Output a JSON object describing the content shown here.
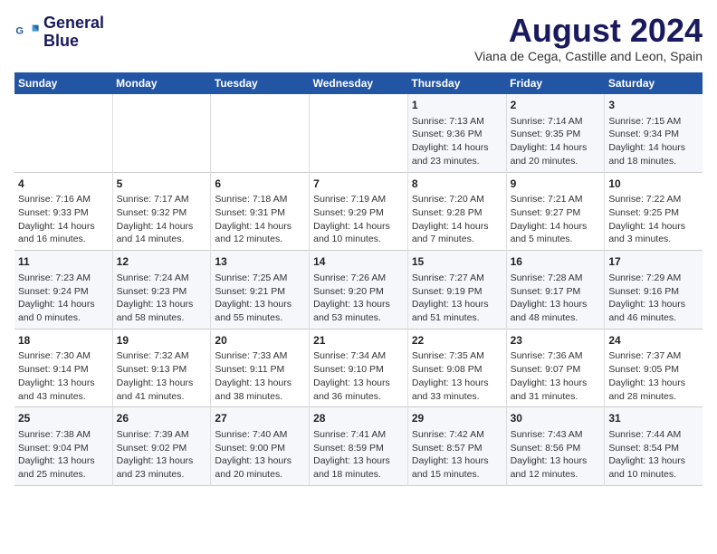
{
  "header": {
    "logo_line1": "General",
    "logo_line2": "Blue",
    "month": "August 2024",
    "location": "Viana de Cega, Castille and Leon, Spain"
  },
  "days_of_week": [
    "Sunday",
    "Monday",
    "Tuesday",
    "Wednesday",
    "Thursday",
    "Friday",
    "Saturday"
  ],
  "weeks": [
    [
      {
        "day": "",
        "content": ""
      },
      {
        "day": "",
        "content": ""
      },
      {
        "day": "",
        "content": ""
      },
      {
        "day": "",
        "content": ""
      },
      {
        "day": "1",
        "content": "Sunrise: 7:13 AM\nSunset: 9:36 PM\nDaylight: 14 hours\nand 23 minutes."
      },
      {
        "day": "2",
        "content": "Sunrise: 7:14 AM\nSunset: 9:35 PM\nDaylight: 14 hours\nand 20 minutes."
      },
      {
        "day": "3",
        "content": "Sunrise: 7:15 AM\nSunset: 9:34 PM\nDaylight: 14 hours\nand 18 minutes."
      }
    ],
    [
      {
        "day": "4",
        "content": "Sunrise: 7:16 AM\nSunset: 9:33 PM\nDaylight: 14 hours\nand 16 minutes."
      },
      {
        "day": "5",
        "content": "Sunrise: 7:17 AM\nSunset: 9:32 PM\nDaylight: 14 hours\nand 14 minutes."
      },
      {
        "day": "6",
        "content": "Sunrise: 7:18 AM\nSunset: 9:31 PM\nDaylight: 14 hours\nand 12 minutes."
      },
      {
        "day": "7",
        "content": "Sunrise: 7:19 AM\nSunset: 9:29 PM\nDaylight: 14 hours\nand 10 minutes."
      },
      {
        "day": "8",
        "content": "Sunrise: 7:20 AM\nSunset: 9:28 PM\nDaylight: 14 hours\nand 7 minutes."
      },
      {
        "day": "9",
        "content": "Sunrise: 7:21 AM\nSunset: 9:27 PM\nDaylight: 14 hours\nand 5 minutes."
      },
      {
        "day": "10",
        "content": "Sunrise: 7:22 AM\nSunset: 9:25 PM\nDaylight: 14 hours\nand 3 minutes."
      }
    ],
    [
      {
        "day": "11",
        "content": "Sunrise: 7:23 AM\nSunset: 9:24 PM\nDaylight: 14 hours\nand 0 minutes."
      },
      {
        "day": "12",
        "content": "Sunrise: 7:24 AM\nSunset: 9:23 PM\nDaylight: 13 hours\nand 58 minutes."
      },
      {
        "day": "13",
        "content": "Sunrise: 7:25 AM\nSunset: 9:21 PM\nDaylight: 13 hours\nand 55 minutes."
      },
      {
        "day": "14",
        "content": "Sunrise: 7:26 AM\nSunset: 9:20 PM\nDaylight: 13 hours\nand 53 minutes."
      },
      {
        "day": "15",
        "content": "Sunrise: 7:27 AM\nSunset: 9:19 PM\nDaylight: 13 hours\nand 51 minutes."
      },
      {
        "day": "16",
        "content": "Sunrise: 7:28 AM\nSunset: 9:17 PM\nDaylight: 13 hours\nand 48 minutes."
      },
      {
        "day": "17",
        "content": "Sunrise: 7:29 AM\nSunset: 9:16 PM\nDaylight: 13 hours\nand 46 minutes."
      }
    ],
    [
      {
        "day": "18",
        "content": "Sunrise: 7:30 AM\nSunset: 9:14 PM\nDaylight: 13 hours\nand 43 minutes."
      },
      {
        "day": "19",
        "content": "Sunrise: 7:32 AM\nSunset: 9:13 PM\nDaylight: 13 hours\nand 41 minutes."
      },
      {
        "day": "20",
        "content": "Sunrise: 7:33 AM\nSunset: 9:11 PM\nDaylight: 13 hours\nand 38 minutes."
      },
      {
        "day": "21",
        "content": "Sunrise: 7:34 AM\nSunset: 9:10 PM\nDaylight: 13 hours\nand 36 minutes."
      },
      {
        "day": "22",
        "content": "Sunrise: 7:35 AM\nSunset: 9:08 PM\nDaylight: 13 hours\nand 33 minutes."
      },
      {
        "day": "23",
        "content": "Sunrise: 7:36 AM\nSunset: 9:07 PM\nDaylight: 13 hours\nand 31 minutes."
      },
      {
        "day": "24",
        "content": "Sunrise: 7:37 AM\nSunset: 9:05 PM\nDaylight: 13 hours\nand 28 minutes."
      }
    ],
    [
      {
        "day": "25",
        "content": "Sunrise: 7:38 AM\nSunset: 9:04 PM\nDaylight: 13 hours\nand 25 minutes."
      },
      {
        "day": "26",
        "content": "Sunrise: 7:39 AM\nSunset: 9:02 PM\nDaylight: 13 hours\nand 23 minutes."
      },
      {
        "day": "27",
        "content": "Sunrise: 7:40 AM\nSunset: 9:00 PM\nDaylight: 13 hours\nand 20 minutes."
      },
      {
        "day": "28",
        "content": "Sunrise: 7:41 AM\nSunset: 8:59 PM\nDaylight: 13 hours\nand 18 minutes."
      },
      {
        "day": "29",
        "content": "Sunrise: 7:42 AM\nSunset: 8:57 PM\nDaylight: 13 hours\nand 15 minutes."
      },
      {
        "day": "30",
        "content": "Sunrise: 7:43 AM\nSunset: 8:56 PM\nDaylight: 13 hours\nand 12 minutes."
      },
      {
        "day": "31",
        "content": "Sunrise: 7:44 AM\nSunset: 8:54 PM\nDaylight: 13 hours\nand 10 minutes."
      }
    ]
  ]
}
